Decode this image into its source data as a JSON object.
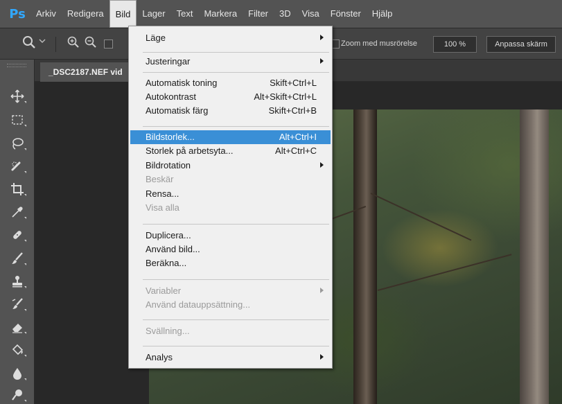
{
  "app": {
    "logo": "Ps",
    "menu": [
      "Arkiv",
      "Redigera",
      "Bild",
      "Lager",
      "Text",
      "Markera",
      "Filter",
      "3D",
      "Visa",
      "Fönster",
      "Hjälp"
    ],
    "active_menu": "Bild"
  },
  "options_bar": {
    "zoom_drag_label": "Zoom med musrörelse",
    "zoom_value": "100 %",
    "fit_button": "Anpassa skärm"
  },
  "document": {
    "tab_label": "_DSC2187.NEF vid"
  },
  "dropdown": {
    "items": [
      {
        "label": "Läge",
        "shortcut": "",
        "submenu": true,
        "disabled": false
      },
      {
        "label": "Justeringar",
        "shortcut": "",
        "submenu": true,
        "disabled": false
      },
      {
        "label": "Automatisk toning",
        "shortcut": "Skift+Ctrl+L",
        "submenu": false,
        "disabled": false
      },
      {
        "label": "Autokontrast",
        "shortcut": "Alt+Skift+Ctrl+L",
        "submenu": false,
        "disabled": false
      },
      {
        "label": "Automatisk färg",
        "shortcut": "Skift+Ctrl+B",
        "submenu": false,
        "disabled": false
      },
      {
        "label": "Bildstorlek...",
        "shortcut": "Alt+Ctrl+I",
        "submenu": false,
        "disabled": false,
        "highlighted": true
      },
      {
        "label": "Storlek på arbetsyta...",
        "shortcut": "Alt+Ctrl+C",
        "submenu": false,
        "disabled": false
      },
      {
        "label": "Bildrotation",
        "shortcut": "",
        "submenu": true,
        "disabled": false
      },
      {
        "label": "Beskär",
        "shortcut": "",
        "submenu": false,
        "disabled": true
      },
      {
        "label": "Rensa...",
        "shortcut": "",
        "submenu": false,
        "disabled": false
      },
      {
        "label": "Visa alla",
        "shortcut": "",
        "submenu": false,
        "disabled": true
      },
      {
        "label": "Duplicera...",
        "shortcut": "",
        "submenu": false,
        "disabled": false
      },
      {
        "label": "Använd bild...",
        "shortcut": "",
        "submenu": false,
        "disabled": false
      },
      {
        "label": "Beräkna...",
        "shortcut": "",
        "submenu": false,
        "disabled": false
      },
      {
        "label": "Variabler",
        "shortcut": "",
        "submenu": true,
        "disabled": true
      },
      {
        "label": "Använd datauppsättning...",
        "shortcut": "",
        "submenu": false,
        "disabled": true
      },
      {
        "label": "Svällning...",
        "shortcut": "",
        "submenu": false,
        "disabled": true
      },
      {
        "label": "Analys",
        "shortcut": "",
        "submenu": true,
        "disabled": false
      }
    ]
  },
  "tools": [
    "move-tool-icon",
    "marquee-tool-icon",
    "lasso-tool-icon",
    "quick-select-tool-icon",
    "crop-tool-icon",
    "eyedropper-tool-icon",
    "healing-brush-tool-icon",
    "brush-tool-icon",
    "clone-stamp-tool-icon",
    "history-brush-tool-icon",
    "eraser-tool-icon",
    "paint-bucket-tool-icon",
    "blur-tool-icon",
    "dodge-tool-icon",
    "pen-tool-icon"
  ],
  "colors": {
    "ps_blue": "#31a8ff",
    "highlight": "#3a8fd6",
    "menu_bg": "#f0f0f0",
    "chrome": "#535353"
  }
}
